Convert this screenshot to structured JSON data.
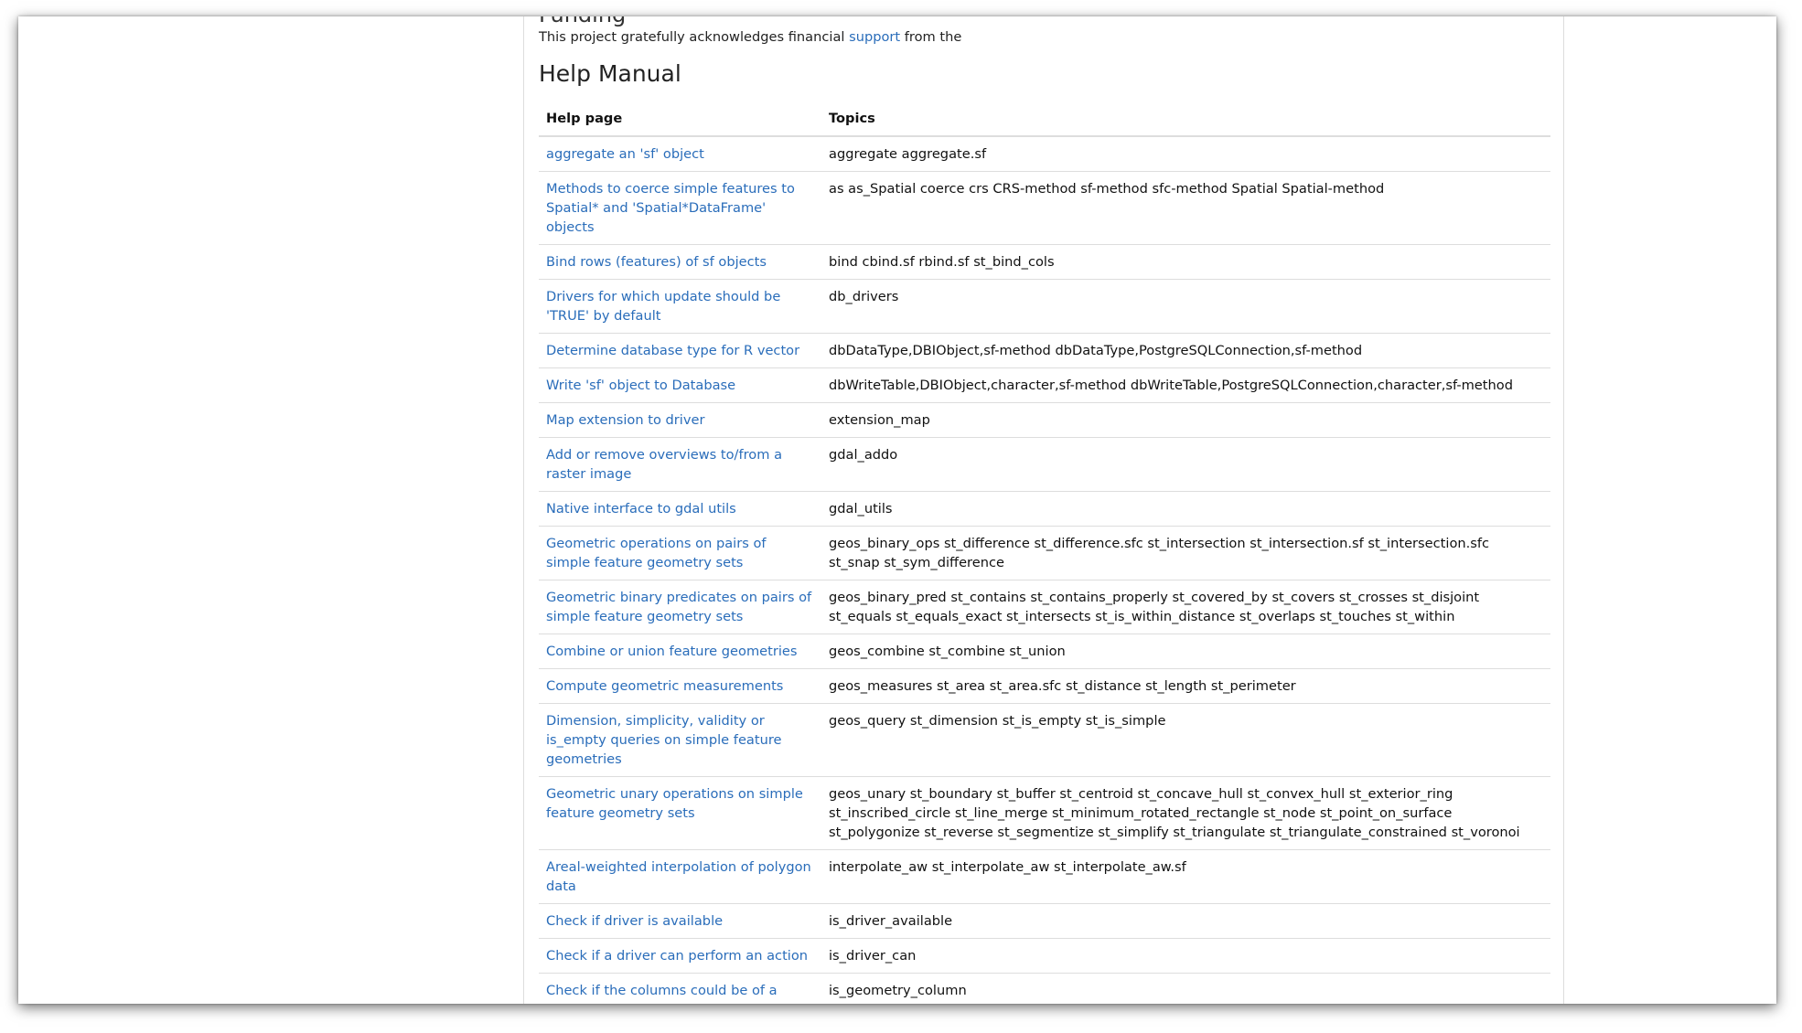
{
  "partial_heading": "Funding",
  "acknowledgement": {
    "before": "This project gratefully acknowledges financial ",
    "link": "support",
    "after": " from the"
  },
  "help_manual": {
    "title": "Help Manual",
    "col_help_page": "Help page",
    "col_topics": "Topics",
    "rows": [
      {
        "page": "aggregate an 'sf' object",
        "topics": "aggregate aggregate.sf"
      },
      {
        "page": "Methods to coerce simple features to Spatial* and 'Spatial*DataFrame' objects",
        "topics": "as as_Spatial coerce crs CRS-method sf-method sfc-method Spatial Spatial-method"
      },
      {
        "page": "Bind rows (features) of sf objects",
        "topics": "bind cbind.sf rbind.sf st_bind_cols"
      },
      {
        "page": "Drivers for which update should be 'TRUE' by default",
        "topics": "db_drivers"
      },
      {
        "page": "Determine database type for R vector",
        "topics": "dbDataType,DBIObject,sf-method dbDataType,PostgreSQLConnection,sf-method"
      },
      {
        "page": "Write 'sf' object to Database",
        "topics": "dbWriteTable,DBIObject,character,sf-method dbWriteTable,PostgreSQLConnection,character,sf-method"
      },
      {
        "page": "Map extension to driver",
        "topics": "extension_map"
      },
      {
        "page": "Add or remove overviews to/from a raster image",
        "topics": "gdal_addo"
      },
      {
        "page": "Native interface to gdal utils",
        "topics": "gdal_utils"
      },
      {
        "page": "Geometric operations on pairs of simple feature geometry sets",
        "topics": "geos_binary_ops st_difference st_difference.sfc st_intersection st_intersection.sf st_intersection.sfc st_snap st_sym_difference"
      },
      {
        "page": "Geometric binary predicates on pairs of simple feature geometry sets",
        "topics": "geos_binary_pred st_contains st_contains_properly st_covered_by st_covers st_crosses st_disjoint st_equals st_equals_exact st_intersects st_is_within_distance st_overlaps st_touches st_within"
      },
      {
        "page": "Combine or union feature geometries",
        "topics": "geos_combine st_combine st_union"
      },
      {
        "page": "Compute geometric measurements",
        "topics": "geos_measures st_area st_area.sfc st_distance st_length st_perimeter"
      },
      {
        "page": "Dimension, simplicity, validity or is_empty queries on simple feature geometries",
        "topics": "geos_query st_dimension st_is_empty st_is_simple"
      },
      {
        "page": "Geometric unary operations on simple feature geometry sets",
        "topics": "geos_unary st_boundary st_buffer st_centroid st_concave_hull st_convex_hull st_exterior_ring st_inscribed_circle st_line_merge st_minimum_rotated_rectangle st_node st_point_on_surface st_polygonize st_reverse st_segmentize st_simplify st_triangulate st_triangulate_constrained st_voronoi"
      },
      {
        "page": "Areal-weighted interpolation of polygon data",
        "topics": "interpolate_aw st_interpolate_aw st_interpolate_aw.sf"
      },
      {
        "page": "Check if driver is available",
        "topics": "is_driver_available"
      },
      {
        "page": "Check if a driver can perform an action",
        "topics": "is_driver_can"
      },
      {
        "page": "Check if the columns could be of a coercable type for sf",
        "topics": "is_geometry_column"
      }
    ]
  }
}
